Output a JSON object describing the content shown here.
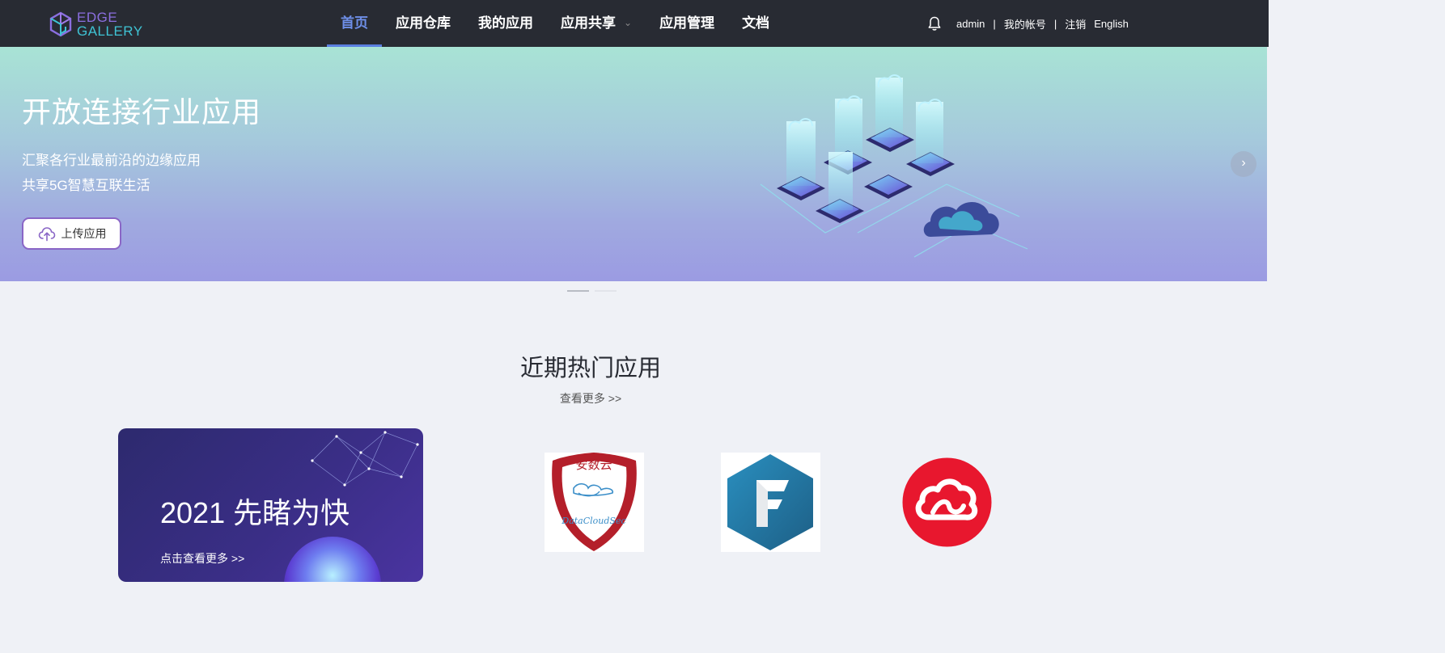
{
  "logo": {
    "line1": "EDGE",
    "line2": "GALLERY"
  },
  "nav": {
    "items": [
      {
        "label": "首页"
      },
      {
        "label": "应用仓库"
      },
      {
        "label": "我的应用"
      },
      {
        "label": "应用共享"
      },
      {
        "label": "应用管理"
      },
      {
        "label": "文档"
      }
    ]
  },
  "user": {
    "name": "admin",
    "separator": "|",
    "account": "我的帐号",
    "logout": "注销",
    "language": "English"
  },
  "banner": {
    "title": "开放连接行业应用",
    "subtitle1": "汇聚各行业最前沿的边缘应用",
    "subtitle2": "共享5G智慧互联生活",
    "upload_label": "上传应用",
    "next_glyph": "›"
  },
  "hot": {
    "title": "近期热门应用",
    "view_more": "查看更多 >>",
    "promo_title": "2021 先睹为快",
    "promo_link": "点击查看更多 >>"
  },
  "apps": [
    {
      "logo_text_top": "安数云",
      "logo_text_bottom": "DataCloudSec"
    },
    {
      "logo_letter": "F"
    },
    {
      "logo": "cloud"
    }
  ]
}
